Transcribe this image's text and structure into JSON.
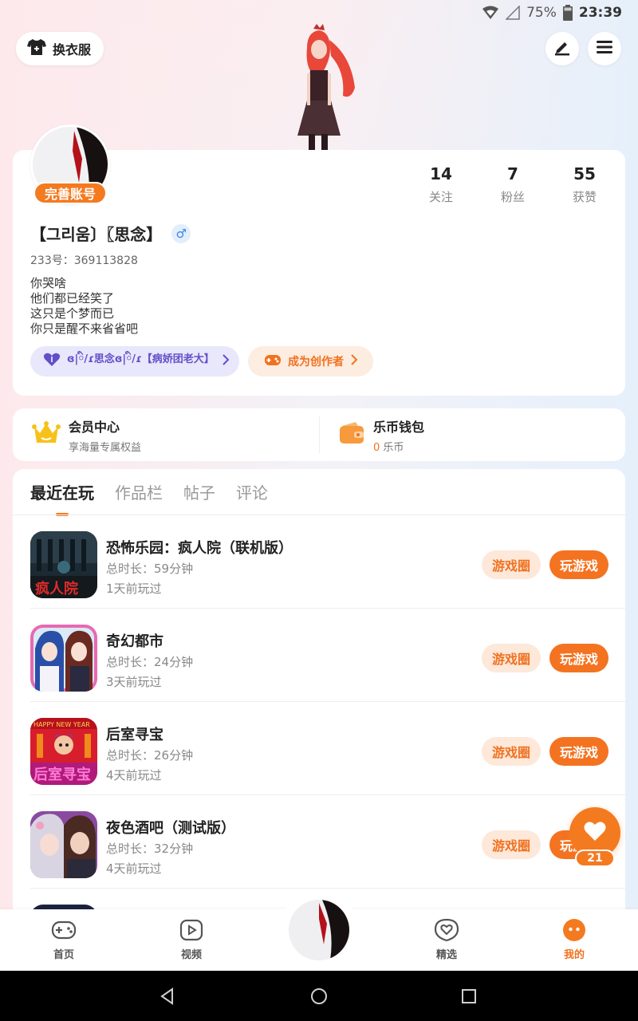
{
  "status_bar": {
    "battery": "75%",
    "time": "23:39"
  },
  "top": {
    "outfit_label": "换衣服"
  },
  "profile": {
    "complete_badge": "完善账号",
    "stats": [
      {
        "num": "14",
        "label": "关注"
      },
      {
        "num": "7",
        "label": "粉丝"
      },
      {
        "num": "55",
        "label": "获赞"
      }
    ],
    "username": "【그리움〕〖思念】",
    "gender": "♂",
    "uid": "233号：369113828",
    "bio": [
      "你哭啥",
      "他们都已经笑了",
      "这只是个梦而已",
      "你只是醒不来省省吧"
    ],
    "guild_chip": "ɞ|ི/ɾ思念ɞ|ི/ɾ【病娇团老大】",
    "creator_chip": "成为创作者"
  },
  "member": {
    "title": "会员中心",
    "sub": "享海量专属权益"
  },
  "wallet": {
    "title": "乐币钱包",
    "amount": "0",
    "unit": "乐币"
  },
  "tabs": [
    "最近在玩",
    "作品栏",
    "帖子",
    "评论"
  ],
  "games": [
    {
      "title": "恐怖乐园：疯人院（联机版）",
      "duration": "总时长：59分钟",
      "last": "1天前玩过",
      "icon_text": "疯人院"
    },
    {
      "title": "奇幻都市",
      "duration": "总时长：24分钟",
      "last": "3天前玩过",
      "icon_text": ""
    },
    {
      "title": "后室寻宝",
      "duration": "总时长：26分钟",
      "last": "4天前玩过",
      "icon_text": "后室寻宝",
      "icon_banner": "HAPPY NEW YEAR"
    },
    {
      "title": "夜色酒吧（测试版）",
      "duration": "总时长：32分钟",
      "last": "4天前玩过",
      "icon_text": ""
    }
  ],
  "game_buttons": {
    "circle": "游戏圈",
    "play": "玩游戏"
  },
  "like": {
    "count": "21"
  },
  "bottom_nav": [
    "首页",
    "视频",
    "精选",
    "我的"
  ],
  "colors": {
    "accent": "#f47a20",
    "guild": "#6150c8",
    "gender": "#3a86e8"
  }
}
